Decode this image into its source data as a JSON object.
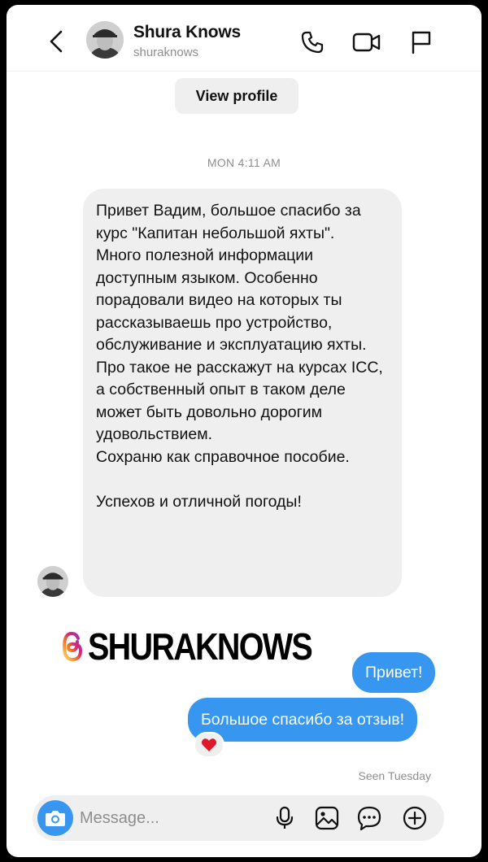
{
  "header": {
    "name": "Shura Knows",
    "username": "shuraknows",
    "icons": [
      "back-chevron-icon",
      "phone-icon",
      "video-camera-icon",
      "flag-icon"
    ]
  },
  "profile": {
    "view_profile_label": "View profile"
  },
  "thread": {
    "timestamp": "MON 4:11 AM",
    "incoming_paragraphs": [
      "Привет Вадим, большое спасибо за курс \"Капитан небольшой яхты\".",
      "Много полезной информации доступным языком. Особенно порадовали видео на которых ты рассказываешь про устройство, обслуживание и эксплуатацию яхты.",
      "Про такое не расскажут на курсах ICC, а собственный опыт в таком деле может быть довольно дорогим удовольствием.",
      "Сохраню как справочное пособие.",
      "",
      "Успехов и отличной погоды!"
    ],
    "outgoing": [
      "Привет!",
      "Большое спасибо за отзыв!"
    ],
    "reaction": "❤️",
    "seen": "Seen Tuesday"
  },
  "watermark": {
    "text": "SHURAKNOWS",
    "icon": "threads-logo-icon"
  },
  "composer": {
    "placeholder": "Message...",
    "icons": [
      "camera-icon",
      "microphone-icon",
      "gallery-icon",
      "sticker-icon",
      "plus-icon"
    ]
  },
  "colors": {
    "accent": "#3797f0",
    "bubble_in": "#efefef",
    "muted": "#8e8e8e"
  }
}
